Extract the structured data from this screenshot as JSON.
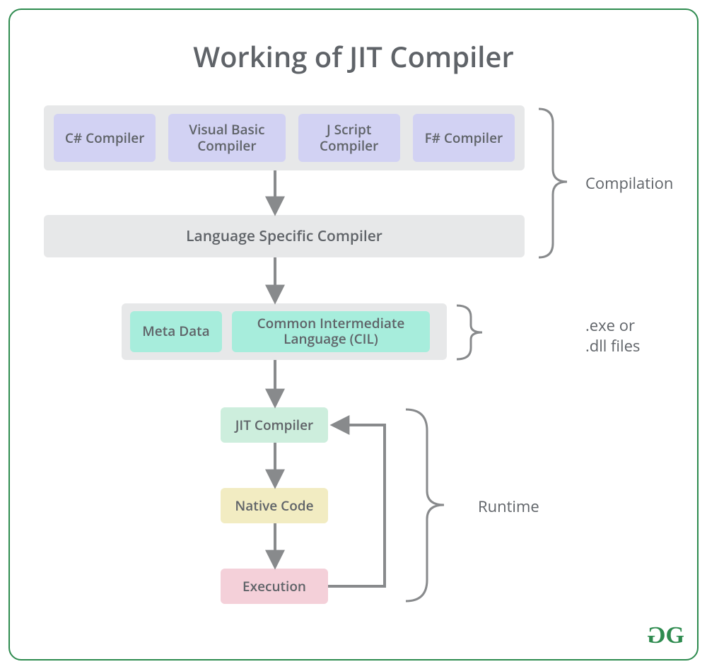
{
  "title": "Working of JIT Compiler",
  "compilers": {
    "items": [
      "C# Compiler",
      "Visual Basic Compiler",
      "J Script Compiler",
      "F# Compiler"
    ]
  },
  "language_specific": "Language Specific Compiler",
  "cil": {
    "meta": "Meta Data",
    "cil_label": "Common Intermediate Language (CIL)"
  },
  "runtime": {
    "jit": "JIT Compiler",
    "native": "Native Code",
    "exec": "Execution"
  },
  "sections": {
    "compilation": "Compilation",
    "files": ".exe or .dll files",
    "runtime": "Runtime"
  },
  "logo": "GG",
  "colors": {
    "frame": "#2e8b4f",
    "text": "#5f6368",
    "group_bg": "#e7e8e9",
    "compiler_bg": "#d2d2f3",
    "cil_bg": "#a7eddc",
    "jit_bg": "#cdeedd",
    "native_bg": "#f2ecc2",
    "exec_bg": "#f4d0d9",
    "arrow": "#888a8c"
  }
}
